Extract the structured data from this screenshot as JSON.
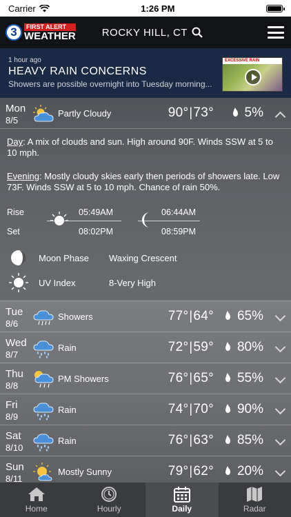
{
  "status_bar": {
    "carrier": "Carrier",
    "time": "1:26 PM"
  },
  "header": {
    "logo_number": "3",
    "logo_line1": "FIRST ALERT",
    "logo_line2": "WEATHER",
    "location": "ROCKY HILL, CT",
    "icons": [
      "search-icon",
      "menu-icon"
    ]
  },
  "news": {
    "time_ago": "1 hour ago",
    "title": "HEAVY RAIN CONCERNS",
    "summary": "Showers are possible overnight into Tuesday morning...",
    "thumb_caption": "EXCESSIVE RAIN"
  },
  "expanded_day": {
    "day": "Mon",
    "date": "8/5",
    "icon": "partly-cloudy-icon",
    "condition": "Partly Cloudy",
    "high": "90°",
    "low": "73°",
    "precip": "5%",
    "day_label": "Day",
    "day_text": ": A mix of clouds and sun. High around 90F. Winds SSW at 5 to 10 mph.",
    "evening_label": "Evening",
    "evening_text": ": Mostly cloudy skies early then periods of showers late. Low 73F. Winds SSW at 5 to 10 mph. Chance of rain 50%.",
    "rise_label": "Rise",
    "set_label": "Set",
    "sunrise": "05:49AM",
    "sunset": "08:02PM",
    "moonrise": "06:44AM",
    "moonset": "08:59PM",
    "moon_phase_label": "Moon Phase",
    "moon_phase": "Waxing Crescent",
    "uv_label": "UV Index",
    "uv_value": "8-Very High"
  },
  "days": [
    {
      "day": "Tue",
      "date": "8/6",
      "icon": "showers-icon",
      "condition": "Showers",
      "high": "77°",
      "low": "64°",
      "precip": "65%"
    },
    {
      "day": "Wed",
      "date": "8/7",
      "icon": "rain-icon",
      "condition": "Rain",
      "high": "72°",
      "low": "59°",
      "precip": "80%"
    },
    {
      "day": "Thu",
      "date": "8/8",
      "icon": "pm-showers-icon",
      "condition": "PM Showers",
      "high": "76°",
      "low": "65°",
      "precip": "55%"
    },
    {
      "day": "Fri",
      "date": "8/9",
      "icon": "rain-icon",
      "condition": "Rain",
      "high": "74°",
      "low": "70°",
      "precip": "90%"
    },
    {
      "day": "Sat",
      "date": "8/10",
      "icon": "rain-icon",
      "condition": "Rain",
      "high": "76°",
      "low": "63°",
      "precip": "85%"
    },
    {
      "day": "Sun",
      "date": "8/11",
      "icon": "mostly-sunny-icon",
      "condition": "Mostly Sunny",
      "high": "79°",
      "low": "62°",
      "precip": "20%"
    }
  ],
  "tabs": [
    {
      "label": "Home",
      "icon": "home-icon",
      "active": false
    },
    {
      "label": "Hourly",
      "icon": "clock-icon",
      "active": false
    },
    {
      "label": "Daily",
      "icon": "calendar-icon",
      "active": true
    },
    {
      "label": "Radar",
      "icon": "map-icon",
      "active": false
    }
  ]
}
